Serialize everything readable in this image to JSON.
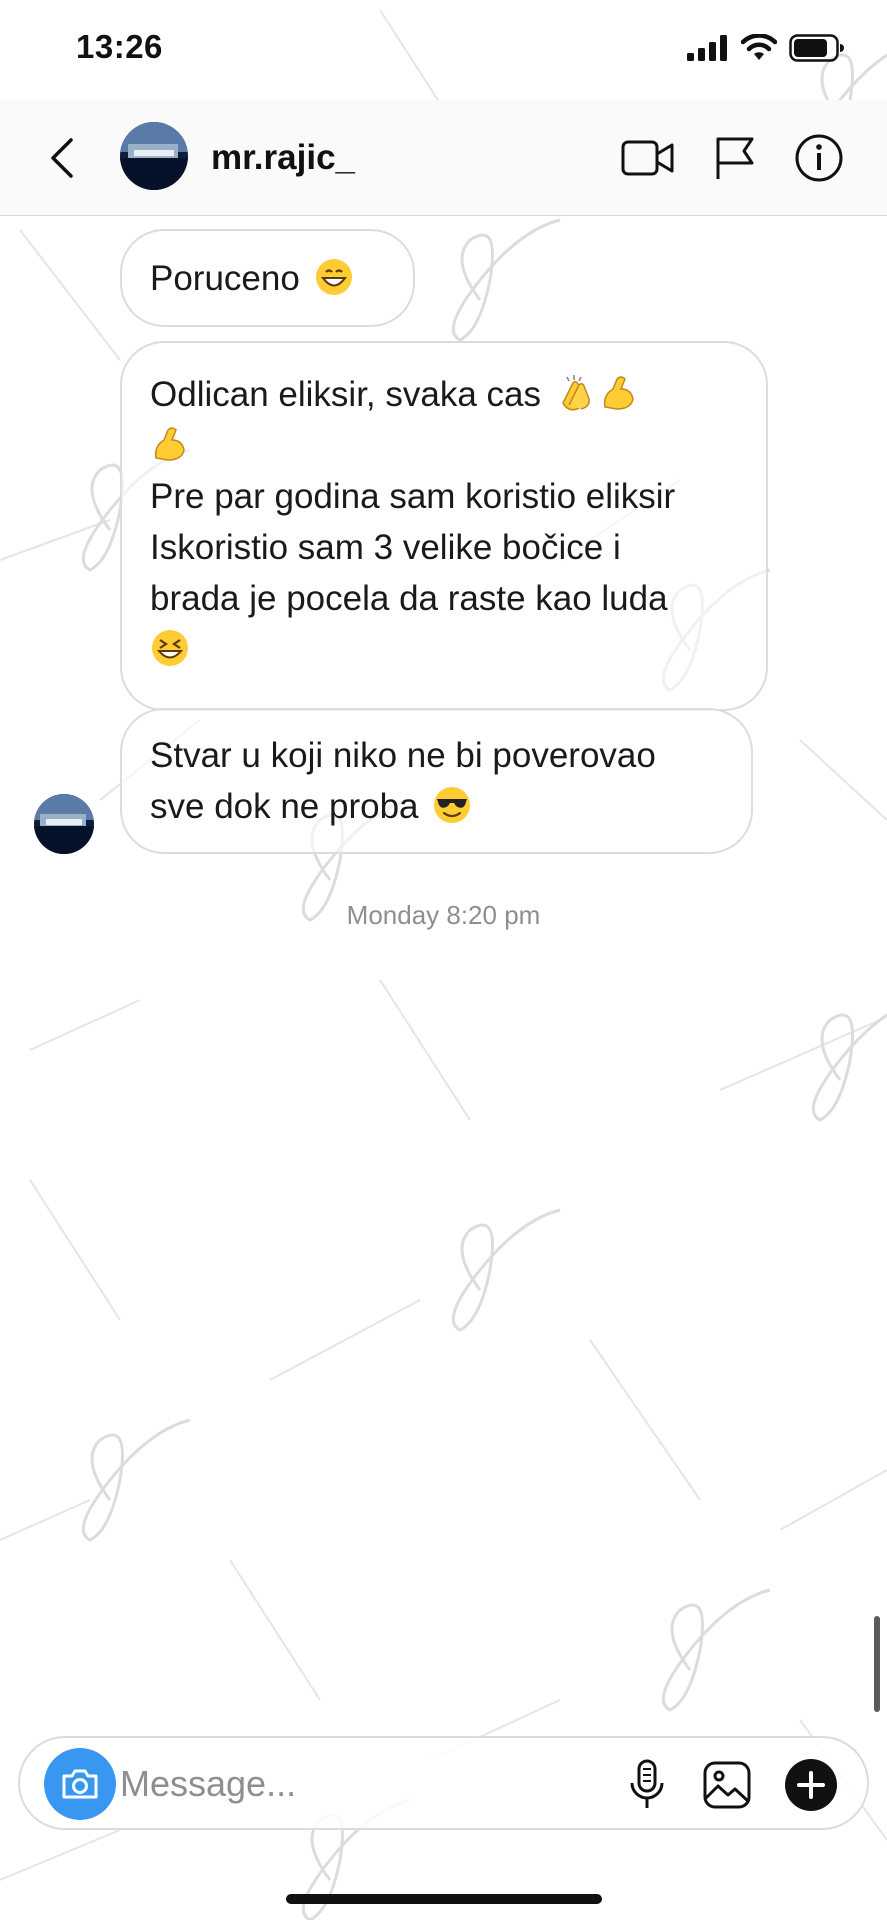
{
  "status_bar": {
    "time": "13:26",
    "icons": [
      "signal-icon",
      "wifi-icon",
      "battery-icon"
    ]
  },
  "header": {
    "username": "mr.rajic_",
    "icons": [
      "back-chevron-icon",
      "video-call-icon",
      "flag-icon",
      "info-icon"
    ]
  },
  "messages": [
    {
      "sender": "mr.rajic_",
      "lines": [
        "Poruceno"
      ],
      "emoji": [
        "grinning-face"
      ]
    },
    {
      "sender": "mr.rajic_",
      "lines": [
        "Odlican eliksir, svaka cas",
        "Pre par godina sam koristio eliksir",
        "Iskoristio sam 3 velike bočice i",
        "brada je pocela da raste kao luda"
      ],
      "emoji": [
        "clapping-hands",
        "flexed-biceps",
        "flexed-biceps",
        "laughing-face"
      ]
    },
    {
      "sender": "mr.rajic_",
      "lines": [
        "Stvar u koji niko ne bi poverovao",
        "sve dok ne proba"
      ],
      "emoji": [
        "sunglasses-face"
      ]
    }
  ],
  "timestamp": "Monday 8:20 pm",
  "composer": {
    "placeholder": "Message...",
    "icons": [
      "camera-icon",
      "microphone-icon",
      "gallery-icon",
      "plus-icon"
    ]
  },
  "colors": {
    "accent": "#3897f0",
    "bubble_border": "#dcdcdc",
    "header_bg": "#fafafa",
    "timestamp": "#8e8e8e"
  },
  "watermark": "Bochemis"
}
